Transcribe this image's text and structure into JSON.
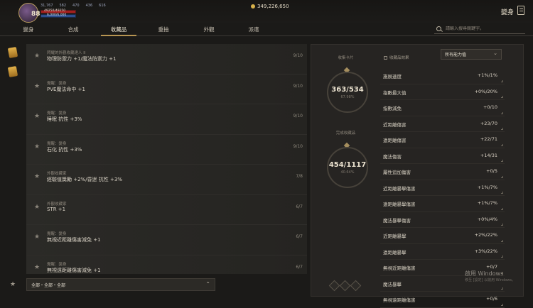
{
  "header": {
    "level": "88",
    "stats": [
      "31,767",
      "582",
      "470",
      "436",
      "616"
    ],
    "hp": "49250/49250",
    "mp": "6,000/6,000",
    "gold": "349,226,650",
    "page_title": "變身"
  },
  "tabs": [
    {
      "label": "變身"
    },
    {
      "label": "合成"
    },
    {
      "label": "收藏品",
      "active": true
    },
    {
      "label": "重抽"
    },
    {
      "label": "外觀"
    },
    {
      "label": "派遣"
    }
  ],
  "search": {
    "placeholder": "請輸入搜尋關鍵字。"
  },
  "collections": [
    {
      "category": "閃耀的外觀收藏達人 II",
      "effect": "物理防禦力 +1/魔法防禦力 +1",
      "count": "9/10"
    },
    {
      "category": "覺醒：變身",
      "effect": "PVE魔法命中 +1",
      "count": "9/10"
    },
    {
      "category": "覺醒：變身",
      "effect": "睡眠 抗性 +3%",
      "count": "9/10"
    },
    {
      "category": "覺醒：變身",
      "effect": "石化 抗性 +3%",
      "count": "9/10"
    },
    {
      "category": "外觀收藏家",
      "effect": "經驗值獎勵 +2%/昏迷 抗性 +3%",
      "count": "7/8"
    },
    {
      "category": "外觀收藏家",
      "effect": "STR +1",
      "count": "6/7"
    },
    {
      "category": "覺醒：變身",
      "effect": "無視近距離傷害減免 +1",
      "count": "6/7"
    },
    {
      "category": "覺醒：變身",
      "effect": "無視遠距離傷害減免 +1",
      "count": "6/7"
    }
  ],
  "filter": {
    "label": "全部・全部・全部"
  },
  "summary": {
    "cards_label": "收集卡片",
    "cards_value": "363/534",
    "cards_pct": "67.98%",
    "completed_label": "完成收藏品",
    "completed_value": "454/1117",
    "completed_pct": "40.64%"
  },
  "effects_header": {
    "checkbox_label": "收藏品效果",
    "dropdown_value": "所有能力值"
  },
  "effects": [
    {
      "name": "施展速度",
      "value": "+1%/1%"
    },
    {
      "name": "指數最大值",
      "value": "+0%/20%"
    },
    {
      "name": "指數減免",
      "value": "+0/10"
    },
    {
      "name": "近距離傷害",
      "value": "+23/70"
    },
    {
      "name": "遠距離傷害",
      "value": "+22/71"
    },
    {
      "name": "魔法傷害",
      "value": "+14/31"
    },
    {
      "name": "屬性追加傷害",
      "value": "+0/5"
    },
    {
      "name": "近距離暴擊傷害",
      "value": "+1%/7%"
    },
    {
      "name": "遠距離暴擊傷害",
      "value": "+1%/7%"
    },
    {
      "name": "魔法暴擊傷害",
      "value": "+0%/4%"
    },
    {
      "name": "近距離暴擊",
      "value": "+2%/22%"
    },
    {
      "name": "遠距離暴擊",
      "value": "+3%/22%"
    },
    {
      "name": "無視近距離傷害",
      "value": "+0/7"
    },
    {
      "name": "魔法暴擊",
      "value": ""
    },
    {
      "name": "無視遠距離傷害",
      "value": "+0/6"
    }
  ],
  "watermark": {
    "line1": "啟用 Windows",
    "line2": "移至 [設定] 以啟用 Windows。"
  }
}
